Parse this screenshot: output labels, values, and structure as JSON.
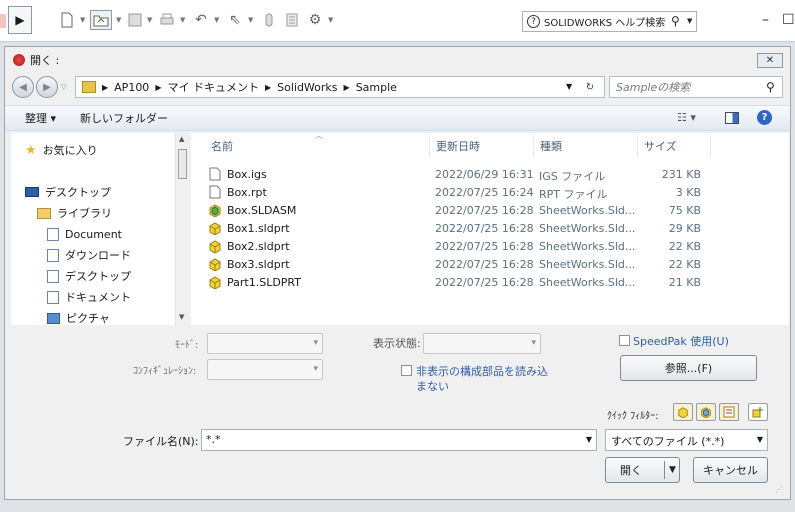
{
  "app": {
    "search_placeholder": "SOLIDWORKS ヘルプ検索"
  },
  "dialog": {
    "title": "開く :",
    "close_label": "✕",
    "address": {
      "crumbs": [
        "AP100",
        "マイ ドキュメント",
        "SolidWorks",
        "Sample"
      ]
    },
    "search_placeholder": "Sampleの検索",
    "commands": {
      "organize": "整理 ▾",
      "new_folder": "新しいフォルダー"
    },
    "nav": {
      "favorites": "お気に入り",
      "desktop": "デスクトップ",
      "library": "ライブラリ",
      "items": [
        "Document",
        "ダウンロード",
        "デスクトップ",
        "ドキュメント",
        "ピクチャ"
      ]
    },
    "columns": {
      "name": "名前",
      "date": "更新日時",
      "type": "種類",
      "size": "サイズ"
    },
    "files": [
      {
        "name": "Box.igs",
        "date": "2022/06/29 16:31",
        "type": "IGS ファイル",
        "size": "231 KB",
        "icon": "doc-icon"
      },
      {
        "name": "Box.rpt",
        "date": "2022/07/25 16:24",
        "type": "RPT ファイル",
        "size": "3 KB",
        "icon": "doc-icon"
      },
      {
        "name": "Box.SLDASM",
        "date": "2022/07/25 16:28",
        "type": "SheetWorks.Sld...",
        "size": "75 KB",
        "icon": "assembly-icon"
      },
      {
        "name": "Box1.sldprt",
        "date": "2022/07/25 16:28",
        "type": "SheetWorks.Sld...",
        "size": "29 KB",
        "icon": "part-icon"
      },
      {
        "name": "Box2.sldprt",
        "date": "2022/07/25 16:28",
        "type": "SheetWorks.Sld...",
        "size": "22 KB",
        "icon": "part-icon"
      },
      {
        "name": "Box3.sldprt",
        "date": "2022/07/25 16:28",
        "type": "SheetWorks.Sld...",
        "size": "22 KB",
        "icon": "part-icon"
      },
      {
        "name": "Part1.SLDPRT",
        "date": "2022/07/25 16:28",
        "type": "SheetWorks.Sld...",
        "size": "21 KB",
        "icon": "part-icon"
      }
    ],
    "options": {
      "mode_label": "ﾓｰﾄﾞ:",
      "config_label": "ｺﾝﾌｨｷﾞｭﾚｰｼｮﾝ:",
      "display_state_label": "表示状態:",
      "speedpak": "SpeedPak 使用(U)",
      "hidden_components_line1": "非表示の構成部品を読み込",
      "hidden_components_line2": "まない",
      "references_button": "参照...(F)",
      "quick_filter_label": "ｸｲｯｸ ﾌｨﾙﾀｰ:"
    },
    "filename_label": "ファイル名(N):",
    "filename_value": "*.*",
    "filetype_value": "すべてのファイル (*.*)",
    "open_button": "開く",
    "cancel_button": "キャンセル"
  }
}
